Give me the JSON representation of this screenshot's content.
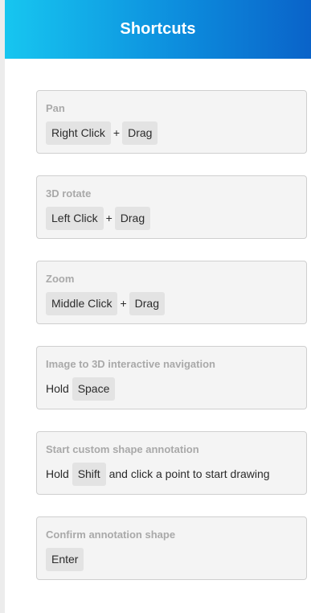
{
  "header": {
    "title": "Shortcuts"
  },
  "shortcuts": [
    {
      "title": "Pan",
      "key1": "Right Click",
      "sep": "+",
      "key2": "Drag"
    },
    {
      "title": "3D rotate",
      "key1": "Left Click",
      "sep": "+",
      "key2": "Drag"
    },
    {
      "title": "Zoom",
      "key1": "Middle Click",
      "sep": "+",
      "key2": "Drag"
    },
    {
      "title": "Image to 3D interactive navigation",
      "prefix": "Hold",
      "key": "Space"
    },
    {
      "title": "Start custom shape annotation",
      "prefix": "Hold",
      "key": "Shift",
      "suffix": "and click a point to start drawing"
    },
    {
      "title": "Confirm annotation shape",
      "key": "Enter"
    }
  ]
}
